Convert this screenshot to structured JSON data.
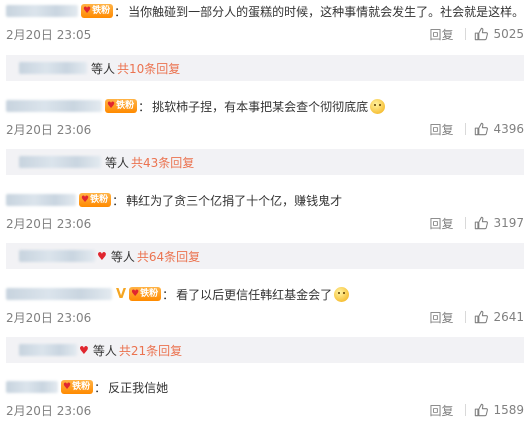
{
  "comments": [
    {
      "badge": "铁粉",
      "has_v": false,
      "text": "当你触碰到一部分人的蛋糕的时候，这种事情就会发生了。社会就是这样。",
      "emoji": false,
      "time": "2月20日 23:05",
      "reply_label": "回复",
      "likes": "5025",
      "replies": {
        "deng": "等人",
        "more": "共10条回复",
        "heart": false
      }
    },
    {
      "badge": "铁粉",
      "has_v": false,
      "text": "挑软柿子捏，有本事把某会查个彻彻底底",
      "emoji": true,
      "time": "2月20日 23:06",
      "reply_label": "回复",
      "likes": "4396",
      "replies": {
        "deng": "等人",
        "more": "共43条回复",
        "heart": false
      }
    },
    {
      "badge": "铁粉",
      "has_v": false,
      "text": "韩红为了贪三个亿捐了十个亿，赚钱鬼才",
      "emoji": false,
      "time": "2月20日 23:06",
      "reply_label": "回复",
      "likes": "3197",
      "replies": {
        "deng": "等人",
        "more": "共64条回复",
        "heart": true
      }
    },
    {
      "badge": "铁粉",
      "has_v": true,
      "text": "看了以后更信任韩红基金会了",
      "emoji": true,
      "time": "2月20日 23:06",
      "reply_label": "回复",
      "likes": "2641",
      "replies": {
        "deng": "等人",
        "more": "共21条回复",
        "heart": true
      }
    },
    {
      "badge": "铁粉",
      "has_v": false,
      "text": "反正我信她",
      "emoji": false,
      "time": "2月20日 23:06",
      "reply_label": "回复",
      "likes": "1589",
      "replies": null
    }
  ],
  "colors": {
    "link_orange": "#eb7350",
    "meta_gray": "#808080",
    "reply_box_bg": "#f2f2f5",
    "badge_orange": "#ff8a00"
  },
  "icons": {
    "like": "thumbs-up-icon",
    "v_mark": "verified-v-icon",
    "fan_badge": "fan-badge-icon"
  }
}
